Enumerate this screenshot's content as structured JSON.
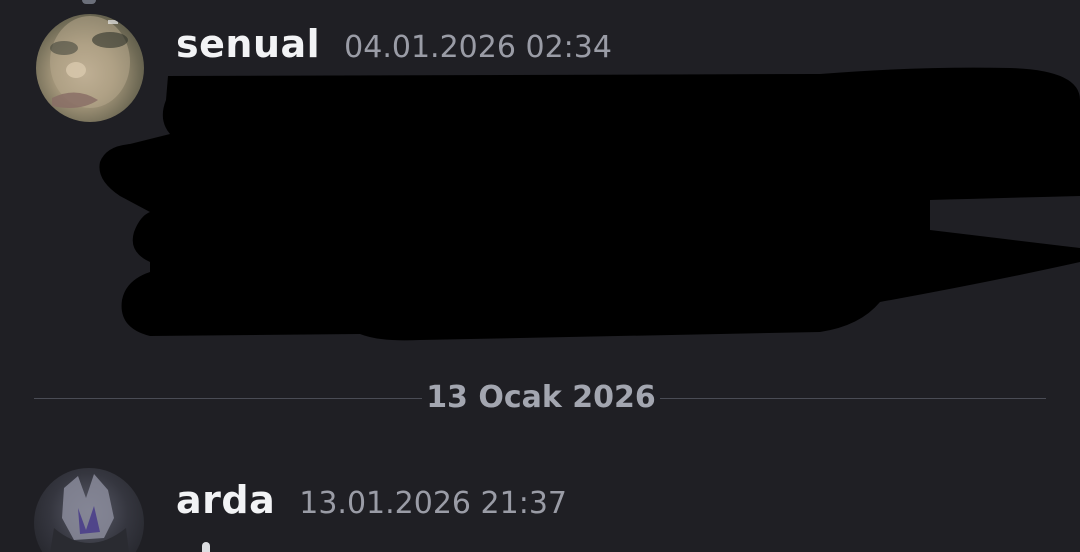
{
  "messages": [
    {
      "username": "senual",
      "timestamp": "04.01.2026 02:34",
      "avatar": "face-photo-avatar",
      "content_redacted": true
    },
    {
      "username": "arda",
      "timestamp": "13.01.2026 21:37",
      "avatar": "dark-figure-avatar"
    }
  ],
  "divider": {
    "date_label": "13 Ocak 2026"
  },
  "colors": {
    "background": "#1f1f24",
    "username": "#f2f3f5",
    "timestamp": "#9a9ca6",
    "divider_line": "#4a4c55",
    "redaction": "#000000"
  }
}
